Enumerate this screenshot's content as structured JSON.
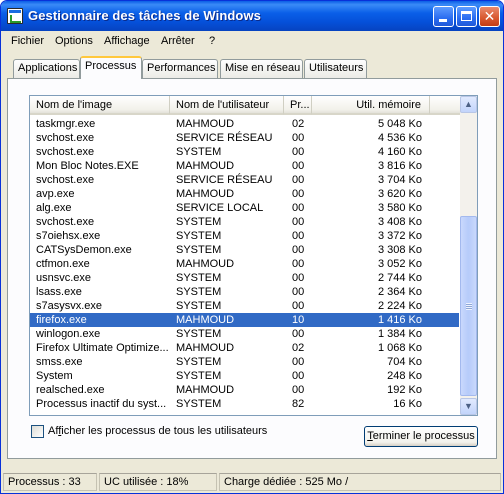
{
  "window": {
    "title": "Gestionnaire des tâches de Windows"
  },
  "menu": [
    "Fichier",
    "Options",
    "Affichage",
    "Arrêter",
    "?"
  ],
  "tabs": [
    "Applications",
    "Processus",
    "Performances",
    "Mise en réseau",
    "Utilisateurs"
  ],
  "active_tab": "Processus",
  "columns": [
    "Nom de l'image",
    "Nom de l'utilisateur",
    "Pr...",
    "Util. mémoire"
  ],
  "processes": [
    {
      "name": "taskmgr.exe",
      "user": "MAHMOUD",
      "cpu": "02",
      "mem": "5 048 Ko"
    },
    {
      "name": "svchost.exe",
      "user": "SERVICE RÉSEAU",
      "cpu": "00",
      "mem": "4 536 Ko"
    },
    {
      "name": "svchost.exe",
      "user": "SYSTEM",
      "cpu": "00",
      "mem": "4 160 Ko"
    },
    {
      "name": "Mon Bloc Notes.EXE",
      "user": "MAHMOUD",
      "cpu": "00",
      "mem": "3 816 Ko"
    },
    {
      "name": "svchost.exe",
      "user": "SERVICE RÉSEAU",
      "cpu": "00",
      "mem": "3 704 Ko"
    },
    {
      "name": "avp.exe",
      "user": "MAHMOUD",
      "cpu": "00",
      "mem": "3 620 Ko"
    },
    {
      "name": "alg.exe",
      "user": "SERVICE LOCAL",
      "cpu": "00",
      "mem": "3 580 Ko"
    },
    {
      "name": "svchost.exe",
      "user": "SYSTEM",
      "cpu": "00",
      "mem": "3 408 Ko"
    },
    {
      "name": "s7oiehsx.exe",
      "user": "SYSTEM",
      "cpu": "00",
      "mem": "3 372 Ko"
    },
    {
      "name": "CATSysDemon.exe",
      "user": "SYSTEM",
      "cpu": "00",
      "mem": "3 308 Ko"
    },
    {
      "name": "ctfmon.exe",
      "user": "MAHMOUD",
      "cpu": "00",
      "mem": "3 052 Ko"
    },
    {
      "name": "usnsvc.exe",
      "user": "SYSTEM",
      "cpu": "00",
      "mem": "2 744 Ko"
    },
    {
      "name": "lsass.exe",
      "user": "SYSTEM",
      "cpu": "00",
      "mem": "2 364 Ko"
    },
    {
      "name": "s7asysvx.exe",
      "user": "SYSTEM",
      "cpu": "00",
      "mem": "2 224 Ko"
    },
    {
      "name": "firefox.exe",
      "user": "MAHMOUD",
      "cpu": "10",
      "mem": "1 416 Ko",
      "selected": true
    },
    {
      "name": "winlogon.exe",
      "user": "SYSTEM",
      "cpu": "00",
      "mem": "1 384 Ko"
    },
    {
      "name": "Firefox Ultimate Optimize...",
      "user": "MAHMOUD",
      "cpu": "02",
      "mem": "1 068 Ko"
    },
    {
      "name": "smss.exe",
      "user": "SYSTEM",
      "cpu": "00",
      "mem": "704 Ko"
    },
    {
      "name": "System",
      "user": "SYSTEM",
      "cpu": "00",
      "mem": "248 Ko"
    },
    {
      "name": "realsched.exe",
      "user": "MAHMOUD",
      "cpu": "00",
      "mem": "192 Ko"
    },
    {
      "name": "Processus inactif du syst...",
      "user": "SYSTEM",
      "cpu": "82",
      "mem": "16 Ko"
    }
  ],
  "show_all_users_label": "Afficher les processus de tous les utilisateurs",
  "show_all_users_checked": false,
  "end_process_label": "Terminer le processus",
  "status": {
    "processes": "Processus : 33",
    "cpu": "UC utilisée : 18%",
    "commit": "Charge dédiée : 525 Mo /"
  },
  "colors": {
    "selection": "#316ac5",
    "titlebar": "#0a5fe8",
    "tab_highlight": "#ffc83c"
  }
}
